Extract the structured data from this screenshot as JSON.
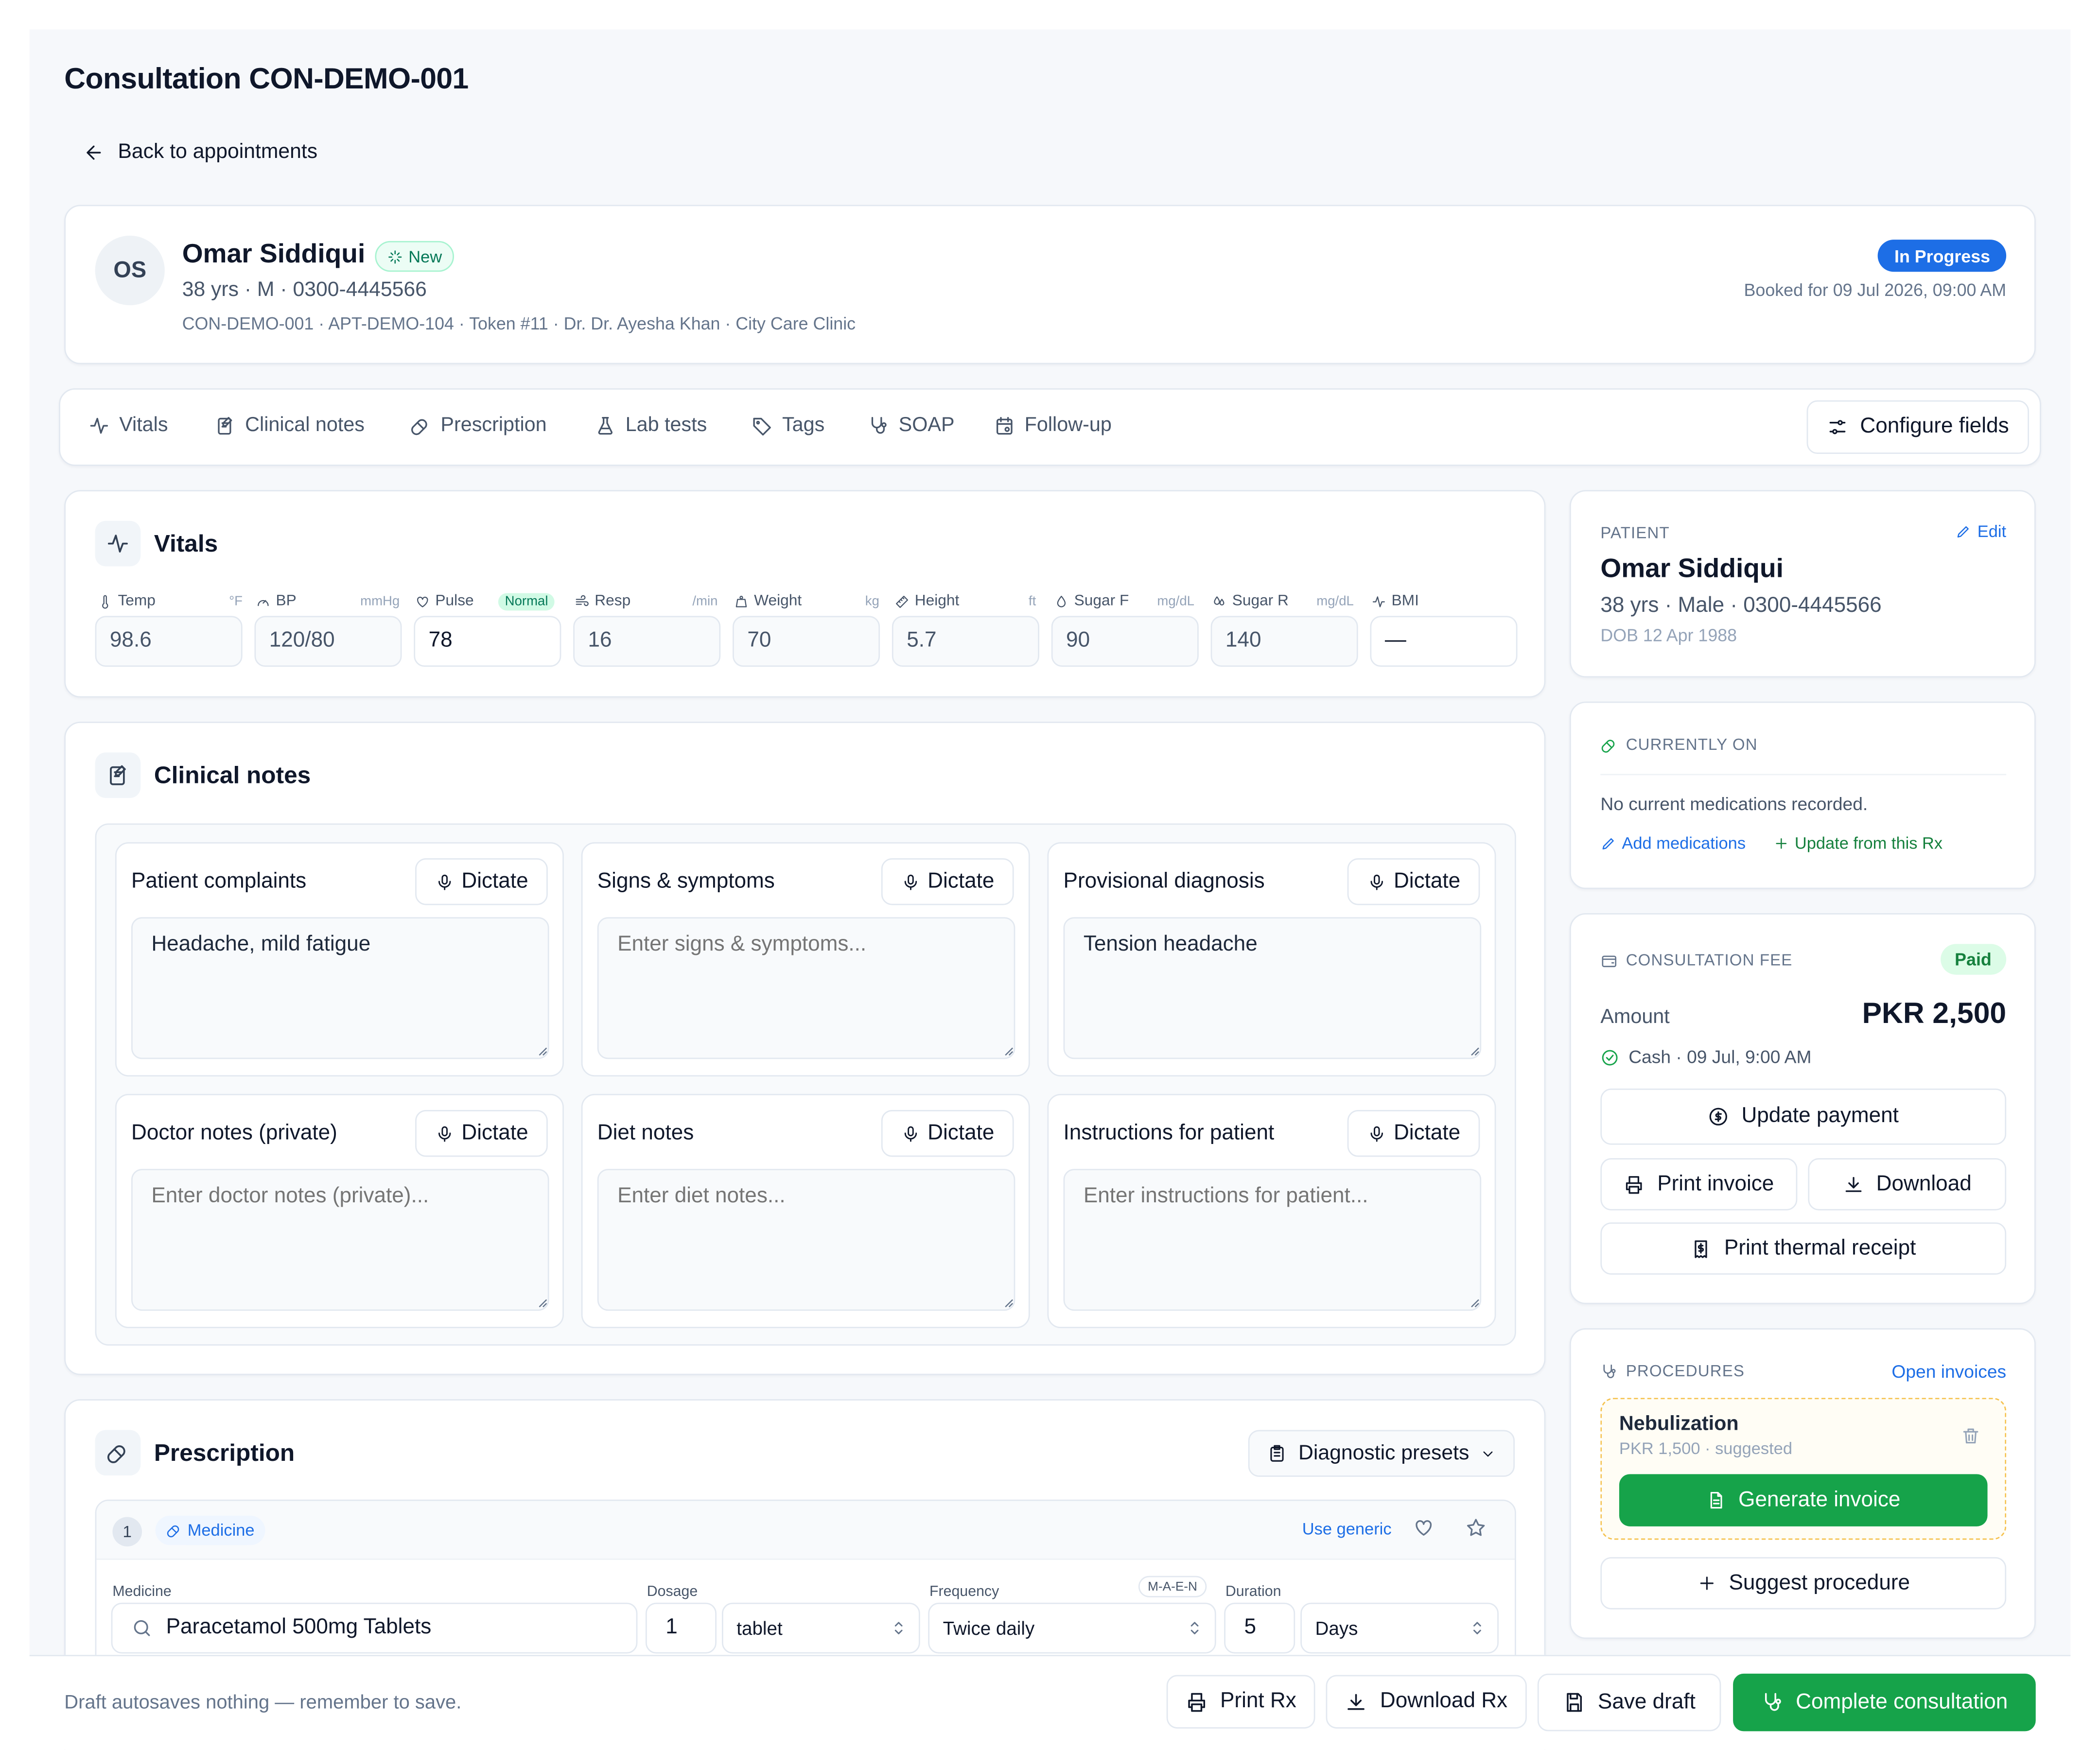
{
  "page": {
    "title": "Consultation CON-DEMO-001",
    "back_label": "Back to appointments"
  },
  "patient_header": {
    "initials": "OS",
    "name": "Omar Siddiqui",
    "badge": "New",
    "meta": "38 yrs · M · 0300-4445566",
    "ids": "CON-DEMO-001 · APT-DEMO-104 · Token #11 · Dr. Dr. Ayesha Khan · City Care Clinic",
    "status": "In Progress",
    "booked": "Booked for 09 Jul 2026, 09:00 AM"
  },
  "tabs": [
    {
      "label": "Vitals",
      "icon": "activity-icon"
    },
    {
      "label": "Clinical notes",
      "icon": "notes-icon"
    },
    {
      "label": "Prescription",
      "icon": "pill-icon"
    },
    {
      "label": "Lab tests",
      "icon": "flask-icon"
    },
    {
      "label": "Tags",
      "icon": "tag-icon"
    },
    {
      "label": "SOAP",
      "icon": "stethoscope-icon"
    },
    {
      "label": "Follow-up",
      "icon": "calendar-icon"
    }
  ],
  "configure_label": "Configure fields",
  "vitals": {
    "title": "Vitals",
    "fields": [
      {
        "label": "Temp",
        "unit": "°F",
        "value": "98.6",
        "filled": false
      },
      {
        "label": "BP",
        "unit": "mmHg",
        "value": "120/80",
        "filled": false
      },
      {
        "label": "Pulse",
        "unit": "",
        "badge": "Normal",
        "value": "78",
        "filled": true
      },
      {
        "label": "Resp",
        "unit": "/min",
        "value": "16",
        "filled": false
      },
      {
        "label": "Weight",
        "unit": "kg",
        "value": "70",
        "filled": false
      },
      {
        "label": "Height",
        "unit": "ft",
        "value": "5.7",
        "filled": false
      },
      {
        "label": "Sugar F",
        "unit": "mg/dL",
        "value": "90",
        "filled": false
      },
      {
        "label": "Sugar R",
        "unit": "mg/dL",
        "value": "140",
        "filled": false
      },
      {
        "label": "BMI",
        "unit": "",
        "value": "—",
        "filled": false
      }
    ]
  },
  "clinical_notes": {
    "title": "Clinical notes",
    "dictate_label": "Dictate",
    "notes": [
      {
        "label": "Patient complaints",
        "value": "Headache, mild fatigue",
        "placeholder": ""
      },
      {
        "label": "Signs & symptoms",
        "value": "",
        "placeholder": "Enter signs & symptoms..."
      },
      {
        "label": "Provisional diagnosis",
        "value": "Tension headache",
        "placeholder": ""
      },
      {
        "label": "Doctor notes (private)",
        "value": "",
        "placeholder": "Enter doctor notes (private)..."
      },
      {
        "label": "Diet notes",
        "value": "",
        "placeholder": "Enter diet notes..."
      },
      {
        "label": "Instructions for patient",
        "value": "",
        "placeholder": "Enter instructions for patient..."
      }
    ]
  },
  "prescription": {
    "title": "Prescription",
    "presets_label": "Diagnostic presets",
    "item_number": "1",
    "item_type": "Medicine",
    "use_generic": "Use generic",
    "labels": {
      "medicine": "Medicine",
      "dosage": "Dosage",
      "frequency": "Frequency",
      "duration": "Duration",
      "maen": "M-A-E-N"
    },
    "medicine": "Paracetamol 500mg Tablets",
    "dosage_qty": "1",
    "dosage_unit": "tablet",
    "frequency": "Twice daily",
    "duration_qty": "5",
    "duration_unit": "Days"
  },
  "patient_card": {
    "heading": "PATIENT",
    "edit_label": "Edit",
    "name": "Omar Siddiqui",
    "meta": "38 yrs · Male · 0300-4445566",
    "dob": "DOB 12 Apr 1988"
  },
  "currently_on": {
    "heading": "CURRENTLY ON",
    "empty": "No current medications recorded.",
    "add_label": "Add medications",
    "update_label": "Update from this Rx"
  },
  "fee": {
    "heading": "CONSULTATION FEE",
    "status": "Paid",
    "amount_label": "Amount",
    "amount": "PKR 2,500",
    "payment": "Cash · 09 Jul, 9:00 AM",
    "update_label": "Update payment",
    "print_label": "Print invoice",
    "download_label": "Download",
    "thermal_label": "Print thermal receipt"
  },
  "procedures": {
    "heading": "PROCEDURES",
    "open_label": "Open invoices",
    "item_name": "Nebulization",
    "item_meta": "PKR 1,500 · suggested",
    "generate_label": "Generate invoice",
    "suggest_label": "Suggest procedure"
  },
  "footer": {
    "note": "Draft autosaves nothing — remember to save.",
    "print_rx": "Print Rx",
    "download_rx": "Download Rx",
    "save_draft": "Save draft",
    "complete": "Complete consultation"
  },
  "colors": {
    "accent": "#1d6ee6",
    "success": "#16a34a",
    "badge_new": "#047857"
  }
}
